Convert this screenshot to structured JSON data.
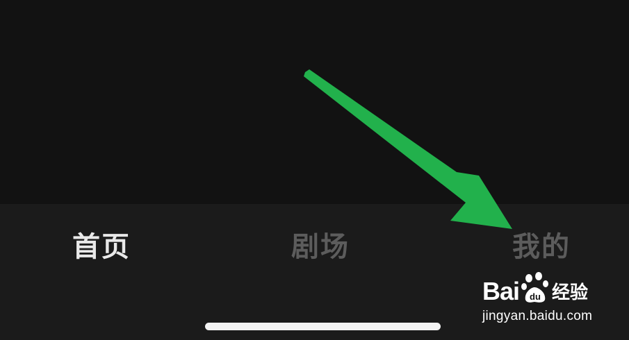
{
  "tabs": [
    {
      "label": "首页",
      "active": true
    },
    {
      "label": "剧场",
      "active": false
    },
    {
      "label": "我的",
      "active": false
    }
  ],
  "colors": {
    "background": "#121212",
    "tab_bar": "#1b1b1b",
    "active_tab": "#e9e9e9",
    "inactive_tab": "#5c5c5c",
    "arrow": "#22b14c",
    "home_indicator": "#f4f4f4"
  },
  "watermark": {
    "brand": "Bai",
    "brand_suffix": "du",
    "product": "经验",
    "url": "jingyan.baidu.com"
  }
}
